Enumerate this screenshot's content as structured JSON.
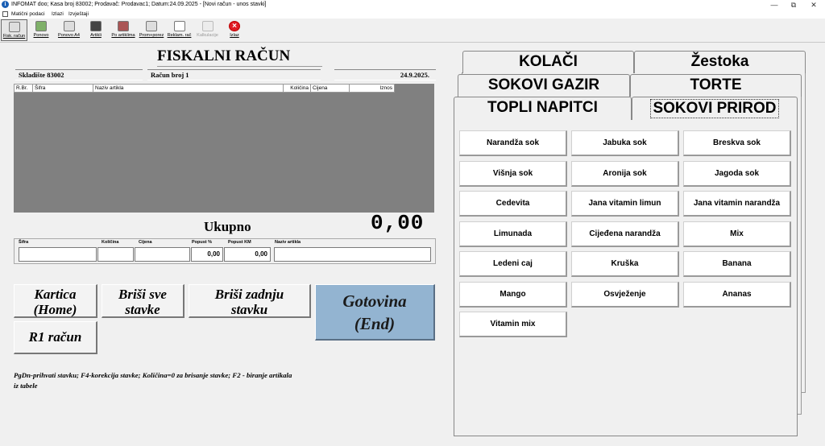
{
  "window": {
    "title": "INFOMAT doo; Kasa broj 83002; Prodavač: Prodavac1; Datum:24.09.2025 - [Novi račun - unos stavki]"
  },
  "menu": [
    "Matični podaci",
    "Izlazi",
    "Izvještaji"
  ],
  "toolbar": [
    {
      "label": "Fisk. račun",
      "icon": "receipt-book-icon"
    },
    {
      "label": "Ponovo",
      "icon": "recycle-bin-icon"
    },
    {
      "label": "Ponovo A4",
      "icon": "reprint-a4-icon"
    },
    {
      "label": "Artikli",
      "icon": "binoculars-icon"
    },
    {
      "label": "Po artiklima",
      "icon": "articles-report-icon"
    },
    {
      "label": "Prom+porez",
      "icon": "tax-report-icon"
    },
    {
      "label": "Reklam. rač",
      "icon": "document-icon"
    },
    {
      "label": "Kalkulacije",
      "icon": "calculation-icon"
    },
    {
      "label": "Izlaz",
      "icon": "exit-icon"
    }
  ],
  "receipt": {
    "title": "FISKALNI RAČUN",
    "warehouse": "Skladište 83002",
    "number": "Račun broj 1",
    "date": "24.9.2025.",
    "columns": [
      "R.Br.",
      "Šifra",
      "Naziv artikla",
      "Količina",
      "Cijena",
      "Iznos"
    ],
    "total_label": "Ukupno",
    "total_value": "0,00"
  },
  "entry": {
    "labels": [
      "Šifra",
      "Količina",
      "Cijena",
      "Popust %",
      "Popust KM",
      "Naziv artikla"
    ],
    "sifra": "",
    "kolicina": "",
    "cijena": "",
    "popust_pct": "0,00",
    "popust_km": "0,00",
    "naziv": ""
  },
  "actions": {
    "kartica_1": "Kartica",
    "kartica_2": "(Home)",
    "brisi_sve_1": "Briši sve",
    "brisi_sve_2": "stavke",
    "brisi_zadnju_1": "Briši zadnju",
    "brisi_zadnju_2": "stavku",
    "gotovina_1": "Gotovina",
    "gotovina_2": "(End)",
    "r1": "R1 račun"
  },
  "help_text": "PgDn-prihvati stavku;  F4-korekcija stavke; Količina=0 za brisanje stavke;    F2 - biranje artikala iz tabele",
  "tabs": {
    "row1": [
      "KOLAČI",
      "Žestoka"
    ],
    "row2": [
      "SOKOVI GAZIR",
      "TORTE"
    ],
    "row3": [
      "TOPLI NAPITCI",
      "SOKOVI PRIROD"
    ],
    "active": "SOKOVI PRIROD"
  },
  "products": [
    "Narandža sok",
    "Jabuka sok",
    "Breskva sok",
    "Višnja sok",
    "Aronija sok",
    "Jagoda sok",
    "Cedevita",
    "Jana vitamin limun",
    "Jana vitamin narandža",
    "Limunada",
    "Cijeđena narandža",
    "Mix",
    "Ledeni caj",
    "Kruška",
    "Banana",
    "Mango",
    "Osvježenje",
    "Ananas",
    "Vitamin mix"
  ]
}
